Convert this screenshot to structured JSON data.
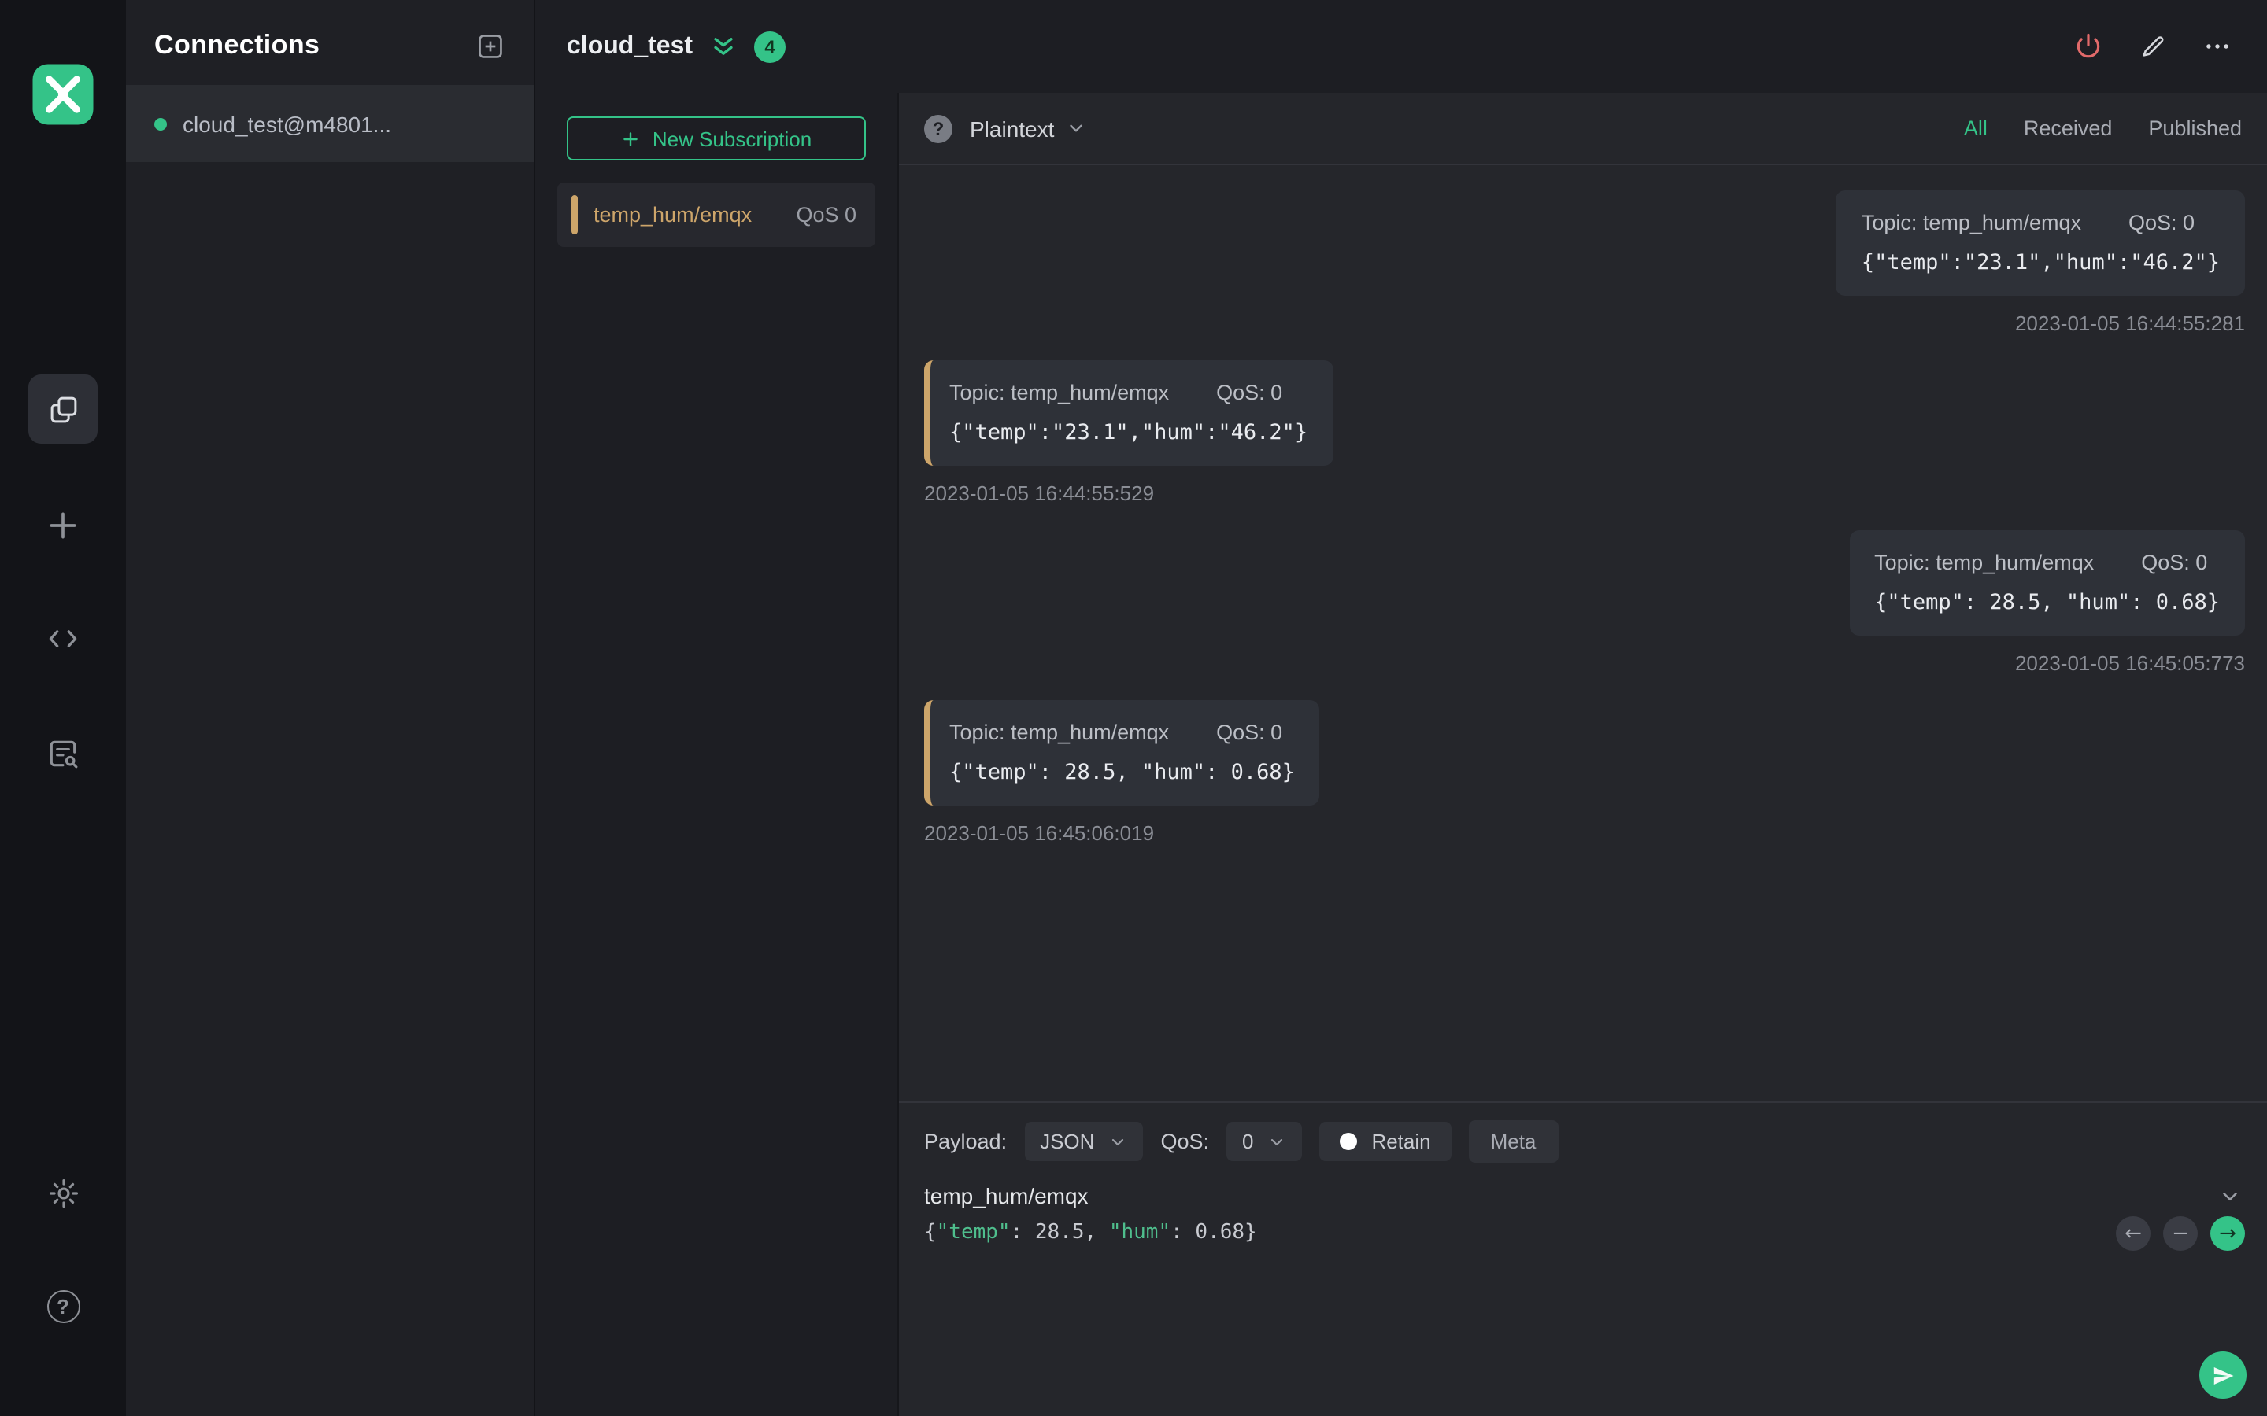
{
  "colors": {
    "accent_green": "#34c388",
    "marker_orange": "#cda56a",
    "danger_red": "#e16a6a",
    "panel_dark": "#1f2025",
    "bubble": "#2e3138"
  },
  "icons": {
    "logo": "mqttx-x-logo",
    "sidebar": [
      "connections-icon",
      "new-connection-plus-icon",
      "script-code-icon",
      "log-icon",
      "settings-gear-icon",
      "help-icon"
    ],
    "header": [
      "disconnect-power-icon",
      "edit-pencil-icon",
      "more-ellipsis-icon"
    ]
  },
  "connections": {
    "title": "Connections",
    "items": [
      {
        "name": "cloud_test@m4801..."
      }
    ]
  },
  "header": {
    "title": "cloud_test",
    "badge": "4"
  },
  "subscriptions": {
    "new_button_label": "New Subscription",
    "items": [
      {
        "topic": "temp_hum/emqx",
        "qos": "QoS 0"
      }
    ]
  },
  "messages": {
    "format_label": "Plaintext",
    "filters": [
      {
        "label": "All",
        "active": true
      },
      {
        "label": "Received",
        "active": false
      },
      {
        "label": "Published",
        "active": false
      }
    ],
    "items": [
      {
        "direction": "published",
        "topic_label": "Topic: temp_hum/emqx",
        "qos_label": "QoS: 0",
        "payload": "{\"temp\":\"23.1\",\"hum\":\"46.2\"}",
        "time": "2023-01-05 16:44:55:281"
      },
      {
        "direction": "received",
        "topic_label": "Topic: temp_hum/emqx",
        "qos_label": "QoS: 0",
        "payload": "{\"temp\":\"23.1\",\"hum\":\"46.2\"}",
        "time": "2023-01-05 16:44:55:529"
      },
      {
        "direction": "published",
        "topic_label": "Topic: temp_hum/emqx",
        "qos_label": "QoS: 0",
        "payload": "{\"temp\": 28.5, \"hum\": 0.68}",
        "time": "2023-01-05 16:45:05:773"
      },
      {
        "direction": "received",
        "topic_label": "Topic: temp_hum/emqx",
        "qos_label": "QoS: 0",
        "payload": "{\"temp\": 28.5, \"hum\": 0.68}",
        "time": "2023-01-05 16:45:06:019"
      }
    ]
  },
  "publish": {
    "payload_label": "Payload:",
    "payload_format": "JSON",
    "qos_label": "QoS:",
    "qos_value": "0",
    "retain_label": "Retain",
    "meta_label": "Meta",
    "topic": "temp_hum/emqx",
    "payload": "{\"temp\": 28.5, \"hum\": 0.68}",
    "history_buttons": [
      "prev",
      "delete",
      "next"
    ]
  }
}
